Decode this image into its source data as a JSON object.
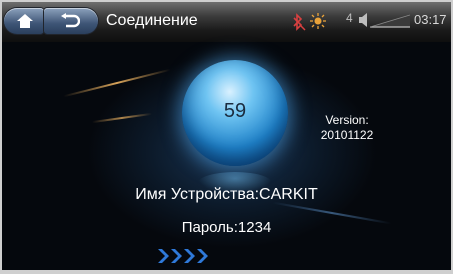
{
  "header": {
    "title": "Соединение",
    "signal_text": "4",
    "time": "03:17"
  },
  "icons": {
    "home": "home-icon",
    "back": "back-icon",
    "bluetooth": "bluetooth-muted-icon",
    "brightness": "sun-icon",
    "volume": "volume-icon",
    "continue": "chevrons-right-icon"
  },
  "colors": {
    "orb": "#1f82c9",
    "accent_arrows": "#2f79d9"
  },
  "main": {
    "orb_value": "59",
    "version_label": "Version:",
    "version_value": "20101122",
    "device_name": "Имя Устройства:CARKIT",
    "password": "Пароль:1234"
  }
}
